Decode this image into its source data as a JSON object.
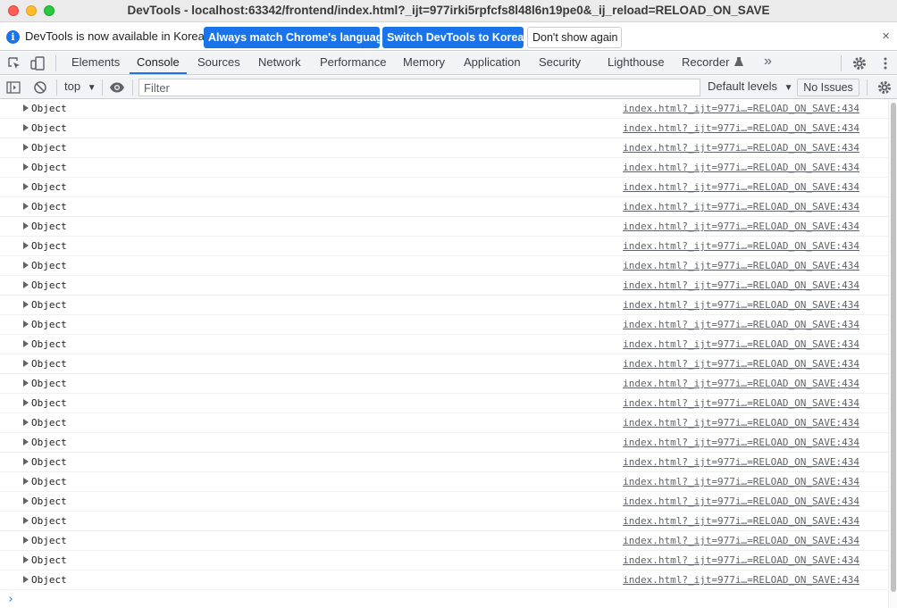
{
  "window": {
    "title": "DevTools - localhost:63342/frontend/index.html?_ijt=977irki5rpfcfs8l48l6n19pe0&_ij_reload=RELOAD_ON_SAVE"
  },
  "infobar": {
    "message": "DevTools is now available in Korean!",
    "match_button": "Always match Chrome's language",
    "switch_button": "Switch DevTools to Korean",
    "dont_show_button": "Don't show again",
    "close": "×"
  },
  "tabs": [
    {
      "label": "Elements"
    },
    {
      "label": "Console"
    },
    {
      "label": "Sources"
    },
    {
      "label": "Network"
    },
    {
      "label": "Performance"
    },
    {
      "label": "Memory"
    },
    {
      "label": "Application"
    },
    {
      "label": "Security"
    },
    {
      "label": "Lighthouse"
    },
    {
      "label": "Recorder"
    }
  ],
  "active_tab": "Console",
  "more_tabs": "»",
  "console_toolbar": {
    "context": "top",
    "filter_placeholder": "Filter",
    "levels": "Default levels",
    "issues": "No Issues"
  },
  "log_entries": [
    {
      "text": "Object",
      "source": "index.html?_ijt=977i…=RELOAD_ON_SAVE:434"
    },
    {
      "text": "Object",
      "source": "index.html?_ijt=977i…=RELOAD_ON_SAVE:434"
    },
    {
      "text": "Object",
      "source": "index.html?_ijt=977i…=RELOAD_ON_SAVE:434"
    },
    {
      "text": "Object",
      "source": "index.html?_ijt=977i…=RELOAD_ON_SAVE:434"
    },
    {
      "text": "Object",
      "source": "index.html?_ijt=977i…=RELOAD_ON_SAVE:434"
    },
    {
      "text": "Object",
      "source": "index.html?_ijt=977i…=RELOAD_ON_SAVE:434"
    },
    {
      "text": "Object",
      "source": "index.html?_ijt=977i…=RELOAD_ON_SAVE:434"
    },
    {
      "text": "Object",
      "source": "index.html?_ijt=977i…=RELOAD_ON_SAVE:434"
    },
    {
      "text": "Object",
      "source": "index.html?_ijt=977i…=RELOAD_ON_SAVE:434"
    },
    {
      "text": "Object",
      "source": "index.html?_ijt=977i…=RELOAD_ON_SAVE:434"
    },
    {
      "text": "Object",
      "source": "index.html?_ijt=977i…=RELOAD_ON_SAVE:434"
    },
    {
      "text": "Object",
      "source": "index.html?_ijt=977i…=RELOAD_ON_SAVE:434"
    },
    {
      "text": "Object",
      "source": "index.html?_ijt=977i…=RELOAD_ON_SAVE:434"
    },
    {
      "text": "Object",
      "source": "index.html?_ijt=977i…=RELOAD_ON_SAVE:434"
    },
    {
      "text": "Object",
      "source": "index.html?_ijt=977i…=RELOAD_ON_SAVE:434"
    },
    {
      "text": "Object",
      "source": "index.html?_ijt=977i…=RELOAD_ON_SAVE:434"
    },
    {
      "text": "Object",
      "source": "index.html?_ijt=977i…=RELOAD_ON_SAVE:434"
    },
    {
      "text": "Object",
      "source": "index.html?_ijt=977i…=RELOAD_ON_SAVE:434"
    },
    {
      "text": "Object",
      "source": "index.html?_ijt=977i…=RELOAD_ON_SAVE:434"
    },
    {
      "text": "Object",
      "source": "index.html?_ijt=977i…=RELOAD_ON_SAVE:434"
    },
    {
      "text": "Object",
      "source": "index.html?_ijt=977i…=RELOAD_ON_SAVE:434"
    },
    {
      "text": "Object",
      "source": "index.html?_ijt=977i…=RELOAD_ON_SAVE:434"
    },
    {
      "text": "Object",
      "source": "index.html?_ijt=977i…=RELOAD_ON_SAVE:434"
    },
    {
      "text": "Object",
      "source": "index.html?_ijt=977i…=RELOAD_ON_SAVE:434"
    },
    {
      "text": "Object",
      "source": "index.html?_ijt=977i…=RELOAD_ON_SAVE:434"
    }
  ],
  "prompt": "›",
  "colors": {
    "accent": "#1a73e8",
    "toolbar_bg": "#f1f3f4",
    "border": "#cacdd1"
  },
  "icons": [
    "inspect-element-icon",
    "device-toolbar-icon",
    "recorder-flask-icon",
    "settings-gear-icon",
    "more-vertical-icon",
    "sidebar-toggle-icon",
    "clear-console-icon",
    "live-expression-eye-icon",
    "console-settings-icon",
    "info-icon",
    "close-icon"
  ]
}
